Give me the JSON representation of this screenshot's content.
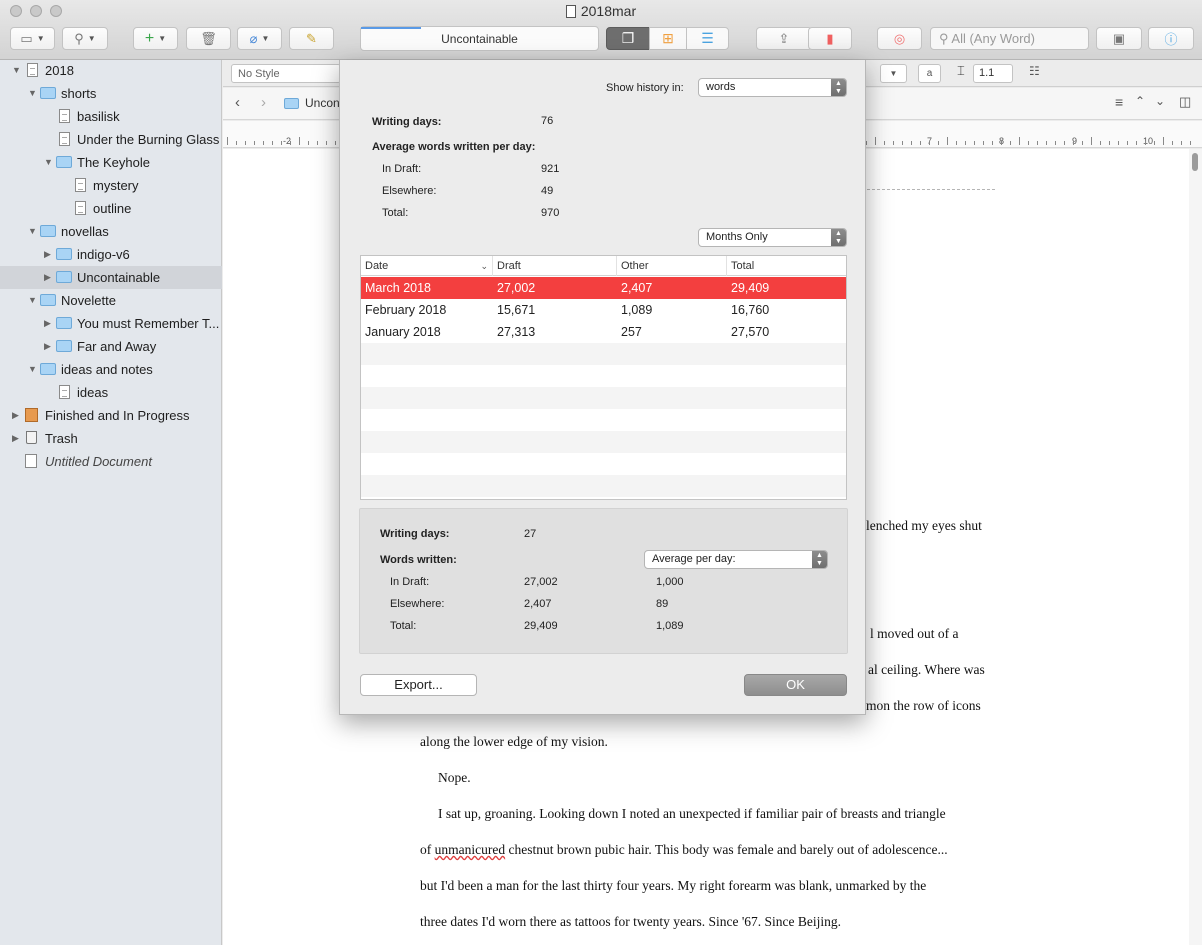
{
  "window": {
    "title": "2018mar"
  },
  "toolbar": {
    "doc_title": "Uncontainable",
    "search_placeholder": "All (Any Word)"
  },
  "binder": {
    "items": [
      {
        "label": "2018"
      },
      {
        "label": "shorts"
      },
      {
        "label": "basilisk"
      },
      {
        "label": "Under the Burning Glass"
      },
      {
        "label": "The Keyhole"
      },
      {
        "label": "mystery"
      },
      {
        "label": "outline"
      },
      {
        "label": "novellas"
      },
      {
        "label": "indigo-v6"
      },
      {
        "label": "Uncontainable"
      },
      {
        "label": "Novelette"
      },
      {
        "label": "You must Remember T..."
      },
      {
        "label": "Far and Away"
      },
      {
        "label": "ideas and notes"
      },
      {
        "label": "ideas"
      },
      {
        "label": "Finished and In Progress"
      },
      {
        "label": "Trash"
      },
      {
        "label": "Untitled Document"
      }
    ]
  },
  "editor": {
    "style_value": "No Style",
    "breadcrumb": "Uncon",
    "line_spacing": "1.1",
    "ruler_labels": [
      "-2",
      "7",
      "8",
      "9",
      "10"
    ],
    "lines": [
      "lenched my eyes shut",
      "l moved out of a",
      "al ceiling. Where was",
      "mon the row of icons",
      "along the lower edge of my vision.",
      "Nope.",
      "I sat up, groaning. Looking down I noted an unexpected if familiar pair of breasts and triangle",
      "chestnut brown pubic hair. This body was female and barely out of adolescence...",
      "but I'd been a man for the last thirty four years. My right forearm was blank, unmarked by the",
      "three dates I'd worn there as tattoos for twenty years. Since '67. Since Beijing."
    ],
    "line10_prefix": "of ",
    "line10_misspelled": "unmanicured"
  },
  "dialog": {
    "show_history_label": "Show history in:",
    "show_history_value": "words",
    "writing_days_label": "Writing days:",
    "writing_days_value": "76",
    "avg_label": "Average words written per day:",
    "in_draft_label": "In Draft:",
    "in_draft_value": "921",
    "elsewhere_label": "Elsewhere:",
    "elsewhere_value": "49",
    "total_label": "Total:",
    "total_value": "970",
    "period_value": "Months Only",
    "table": {
      "headers": [
        "Date",
        "Draft",
        "Other",
        "Total"
      ],
      "rows": [
        {
          "date": "March 2018",
          "draft": "27,002",
          "other": "2,407",
          "total": "29,409"
        },
        {
          "date": "February 2018",
          "draft": "15,671",
          "other": "1,089",
          "total": "16,760"
        },
        {
          "date": "January 2018",
          "draft": "27,313",
          "other": "257",
          "total": "27,570"
        }
      ]
    },
    "summary": {
      "writing_days_label": "Writing days:",
      "writing_days_value": "27",
      "words_written_label": "Words written:",
      "mode_value": "Average per day:",
      "in_draft_label": "In Draft:",
      "in_draft_value": "27,002",
      "in_draft_avg": "1,000",
      "elsewhere_label": "Elsewhere:",
      "elsewhere_value": "2,407",
      "elsewhere_avg": "89",
      "total_label": "Total:",
      "total_value": "29,409",
      "total_avg": "1,089"
    },
    "export_label": "Export...",
    "ok_label": "OK"
  },
  "colors": {
    "selected_row": "#f33f3f",
    "folder": "#a9d4f5",
    "binder_bg": "#e3e7ec"
  }
}
